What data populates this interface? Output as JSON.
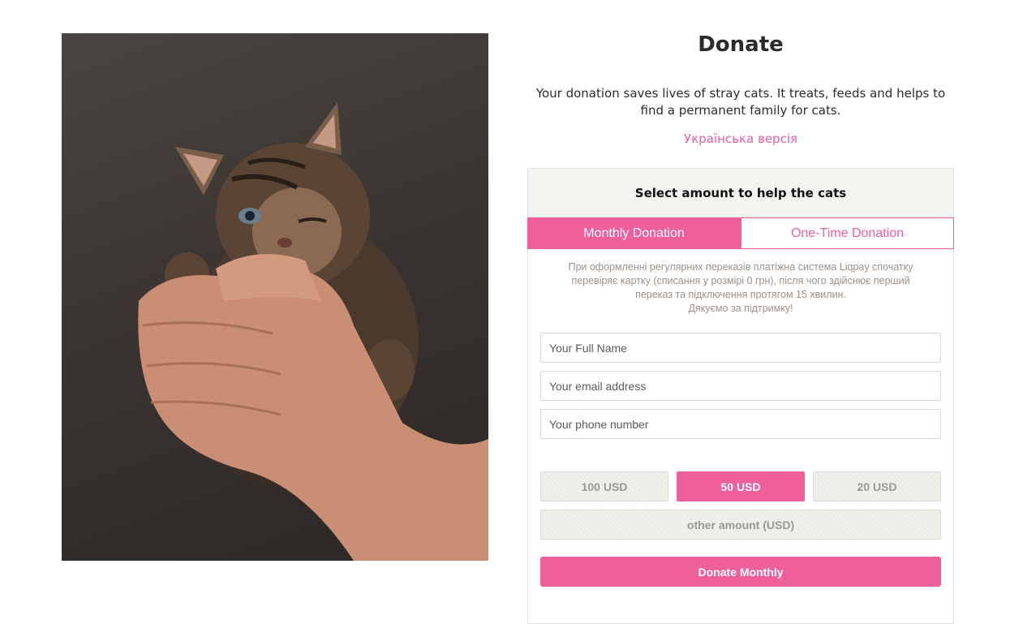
{
  "page": {
    "title": "Donate",
    "intro": "Your donation saves lives of stray cats. It treats, feeds and helps to find a permanent family for cats.",
    "language_link": "Українська версія"
  },
  "photo": {
    "subject": "kitten-held-in-hands"
  },
  "form": {
    "header": "Select amount to help the cats",
    "tabs": [
      {
        "label": "Monthly Donation",
        "active": true
      },
      {
        "label": "One-Time Donation",
        "active": false
      }
    ],
    "notice_lines": [
      "При оформленні регулярних переказів платіжна система Liqpay спочатку",
      "перевіряє картку (списання у розмірі 0 грн), після чого здійснює перший",
      "переказ та підключення протягом 15 хвилин.",
      "Дякуємо за підтримку!"
    ],
    "fields": {
      "name_placeholder": "Your Full Name",
      "email_placeholder": "Your email address",
      "phone_placeholder": "Your phone number"
    },
    "amounts": [
      {
        "label": "100 USD",
        "selected": false
      },
      {
        "label": "50 USD",
        "selected": true
      },
      {
        "label": "20 USD",
        "selected": false
      }
    ],
    "other_amount": "other amount (USD)",
    "submit": "Donate Monthly"
  },
  "colors": {
    "accent": "#ef5f9c",
    "header_bg": "#f3f3f0",
    "muted_text": "#9a9088"
  }
}
